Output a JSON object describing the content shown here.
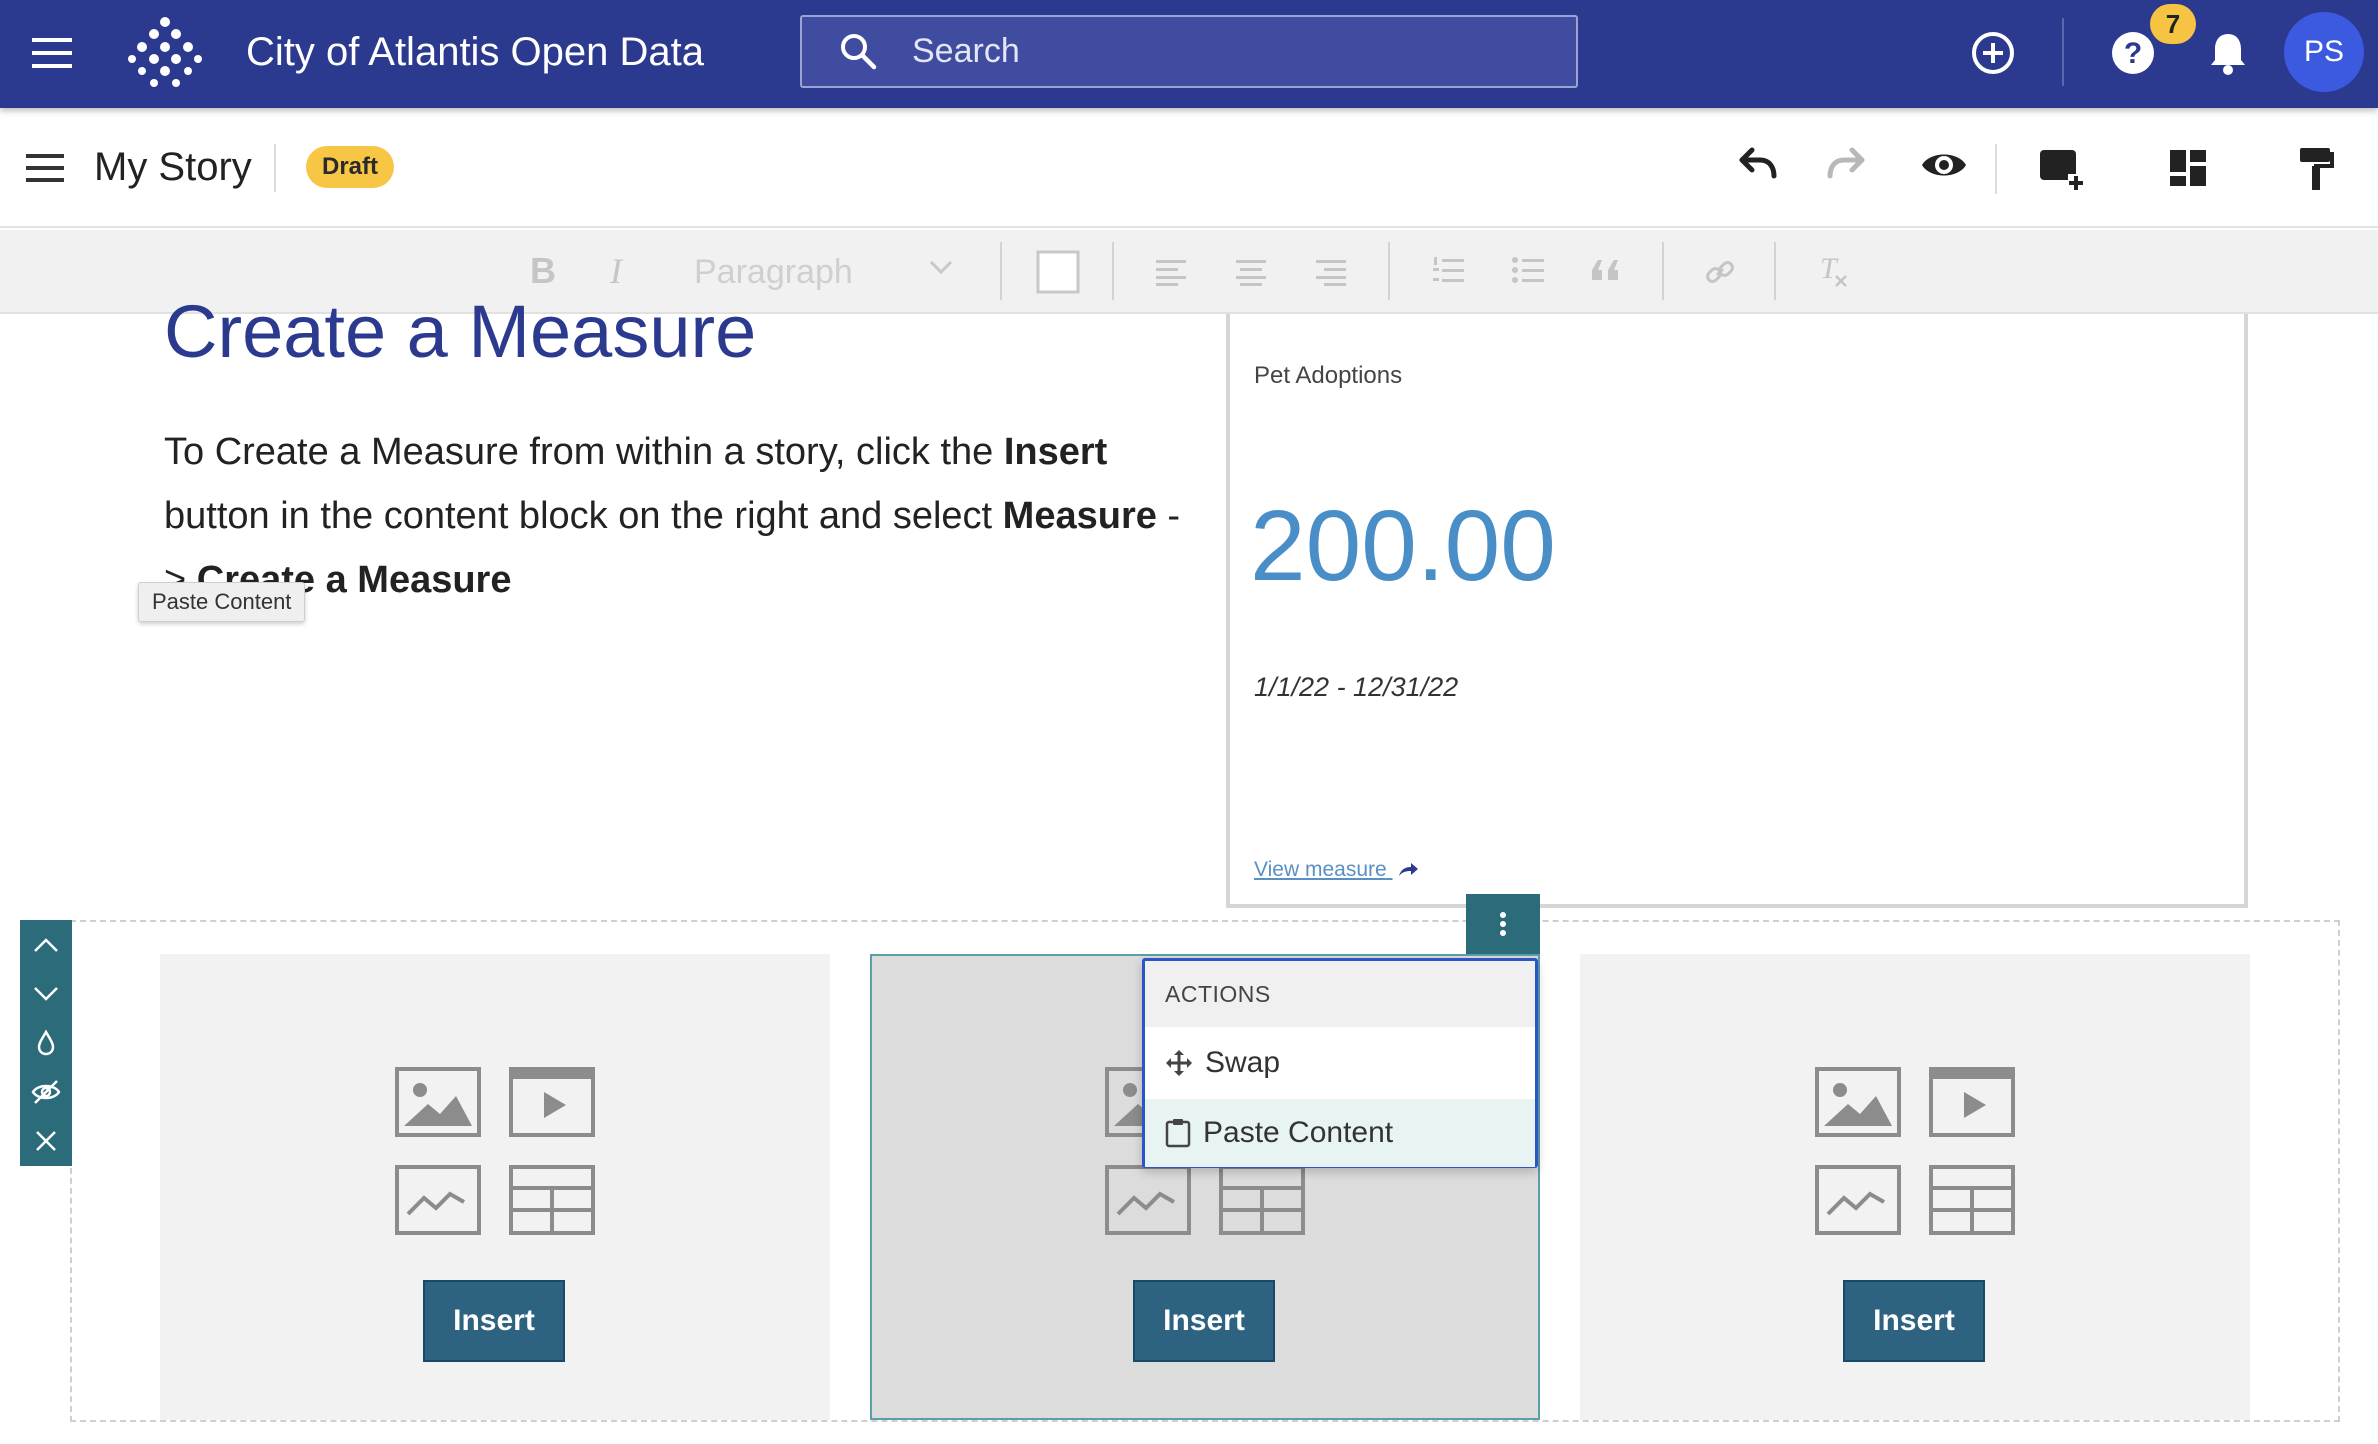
{
  "top_bar": {
    "site_title": "City of Atlantis Open Data",
    "search_placeholder": "Search",
    "notification_count": "7",
    "avatar_initials": "PS",
    "bg_color": "#2b3a8f"
  },
  "story_bar": {
    "title": "My Story",
    "status_badge": "Draft"
  },
  "format_toolbar": {
    "block_style": "Paragraph"
  },
  "content": {
    "heading": "Create a Measure",
    "para_1": "To Create a Measure from within a story, click the ",
    "para_bold_1": "Insert",
    "para_2": " button in the content block on the right and select ",
    "para_bold_2": "Measure",
    "para_3": " -> ",
    "para_bold_3": "Create a Measure",
    "tooltip": "Paste Content"
  },
  "measure_card": {
    "title": "Pet Adoptions",
    "value": "200.00",
    "date_range": "1/1/22 - 12/31/22",
    "link_text": "View measure"
  },
  "section": {
    "blocks": [
      {
        "insert_label": "Insert"
      },
      {
        "insert_label": "Insert"
      },
      {
        "insert_label": "Insert"
      }
    ]
  },
  "actions_menu": {
    "header": "ACTIONS",
    "items": [
      {
        "label": "Swap",
        "icon": "move-icon"
      },
      {
        "label": "Paste Content",
        "icon": "clipboard-icon"
      }
    ]
  }
}
